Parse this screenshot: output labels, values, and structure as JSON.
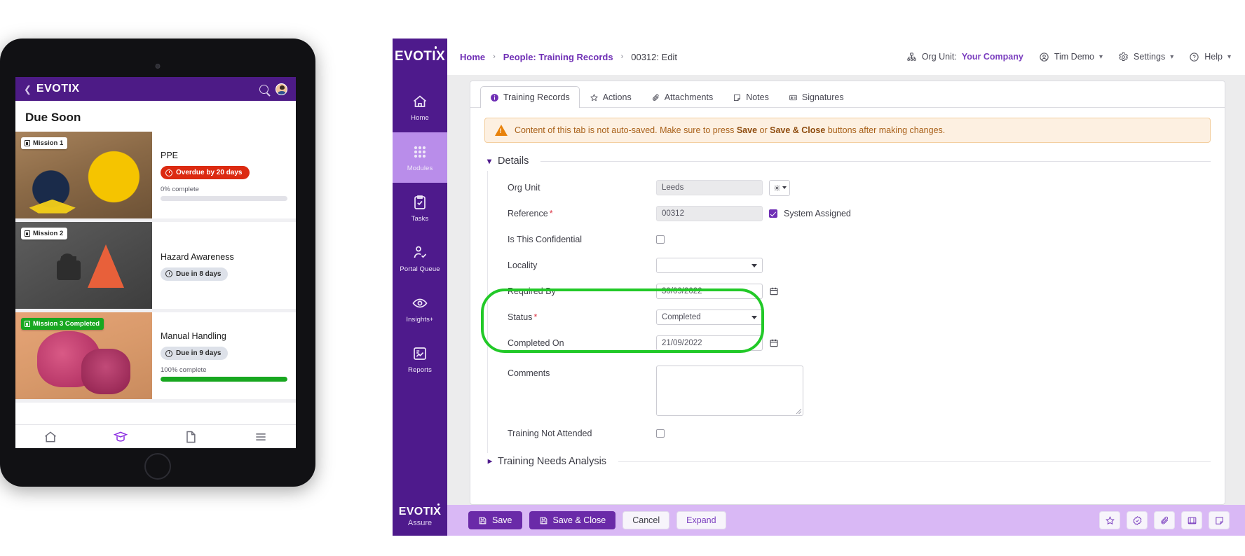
{
  "tablet": {
    "topbar": {
      "back_icon": "chevron-left-icon",
      "logo": "EVOTIX",
      "search_icon": "search-icon",
      "avatar_icon": "user-avatar"
    },
    "heading": "Due Soon",
    "missions": [
      {
        "badge": "Mission 1",
        "badge_style": "white",
        "title": "PPE",
        "pill": "Overdue by 20 days",
        "pill_style": "red",
        "percent_label": "0% complete",
        "percent": 0,
        "image": "ppe-boots-helmet-photo"
      },
      {
        "badge": "Mission 2",
        "badge_style": "white",
        "title": "Hazard Awareness",
        "pill": "Due in 8 days",
        "pill_style": "grey",
        "percent_label": "",
        "percent": null,
        "image": "traffic-cone-locked-photo"
      },
      {
        "badge": "Mission 3 Completed",
        "badge_style": "green",
        "title": "Manual Handling",
        "pill": "Due in 9 days",
        "pill_style": "grey",
        "percent_label": "100% complete",
        "percent": 100,
        "image": "manual-handling-sacks-photo"
      }
    ],
    "bottom_nav": [
      "home-icon",
      "graduation-cap-icon",
      "document-icon",
      "menu-icon"
    ]
  },
  "app": {
    "sidebar": {
      "logo": "EVOTIX",
      "items": [
        {
          "label": "Home",
          "icon": "home-icon",
          "active": false
        },
        {
          "label": "Modules",
          "icon": "grid-dots-icon",
          "active": true
        },
        {
          "label": "Tasks",
          "icon": "clipboard-check-icon",
          "active": false
        },
        {
          "label": "Portal Queue",
          "icon": "user-check-icon",
          "active": false
        },
        {
          "label": "Insights+",
          "icon": "eye-icon",
          "active": false
        },
        {
          "label": "Reports",
          "icon": "report-chart-icon",
          "active": false
        }
      ],
      "footer_logo": "EVOTIX",
      "footer_sub": "Assure"
    },
    "breadcrumb": [
      {
        "label": "Home",
        "link": true
      },
      {
        "label": "People: Training Records",
        "link": true
      },
      {
        "label": "00312: Edit",
        "link": false
      }
    ],
    "breadcrumb_separator": "›",
    "topbar_right": {
      "org_unit_label": "Org Unit:",
      "org_unit_value": "Your Company",
      "org_unit_icon": "org-chart-icon",
      "user_name": "Tim Demo",
      "user_icon": "user-circle-icon",
      "settings_label": "Settings",
      "settings_icon": "gear-icon",
      "help_label": "Help",
      "help_icon": "question-circle-icon",
      "chevron": "∨"
    },
    "tabs": [
      {
        "label": "Training Records",
        "icon": "info-circle-icon",
        "active": true
      },
      {
        "label": "Actions",
        "icon": "star-icon",
        "active": false
      },
      {
        "label": "Attachments",
        "icon": "paperclip-icon",
        "active": false
      },
      {
        "label": "Notes",
        "icon": "note-icon",
        "active": false
      },
      {
        "label": "Signatures",
        "icon": "signature-icon",
        "active": false
      }
    ],
    "alert": {
      "icon": "warning-triangle-icon",
      "text_before": "Content of this tab is not auto-saved. Make sure to press ",
      "bold_1": "Save",
      "text_mid": " or ",
      "bold_2": "Save & Close",
      "text_after": " buttons after making changes."
    },
    "sections": [
      {
        "title": "Details",
        "expanded": true
      },
      {
        "title": "Training Needs Analysis",
        "expanded": false
      }
    ],
    "fields": {
      "org_unit": {
        "label": "Org Unit",
        "value": "Leeds",
        "readonly": true,
        "gear_icon": "gear-dropdown-icon"
      },
      "reference": {
        "label": "Reference",
        "required": true,
        "value": "00312",
        "readonly": true,
        "checkbox_label": "System Assigned",
        "checked": true
      },
      "confidential": {
        "label": "Is This Confidential",
        "checked": false
      },
      "locality": {
        "label": "Locality",
        "value": "",
        "options": [
          ""
        ]
      },
      "required_by": {
        "label": "Required By",
        "value": "30/09/2022",
        "calendar_icon": "calendar-icon"
      },
      "status": {
        "label": "Status",
        "required": true,
        "value": "Completed",
        "options": [
          "Completed"
        ]
      },
      "completed_on": {
        "label": "Completed On",
        "value": "21/09/2022",
        "calendar_icon": "calendar-icon"
      },
      "comments": {
        "label": "Comments",
        "value": ""
      },
      "not_attended": {
        "label": "Training Not Attended",
        "checked": false
      }
    },
    "footer": {
      "save": "Save",
      "save_close": "Save & Close",
      "cancel": "Cancel",
      "expand": "Expand",
      "save_icon": "floppy-disk-icon",
      "tool_icons": [
        "star-icon",
        "badge-check-icon",
        "paperclip-icon",
        "book-icon",
        "note-icon"
      ]
    },
    "colors": {
      "brand_purple": "#4e1a8c",
      "accent_purple": "#6f2fb5",
      "footer_purple": "#d9b8f5",
      "highlight_green": "#22c928",
      "alert_orange": "#e8820b",
      "overdue_red": "#dc2a11",
      "complete_green": "#18a720"
    },
    "highlight": {
      "target": "status-and-completed-on-fields",
      "color": "#22c928"
    }
  }
}
